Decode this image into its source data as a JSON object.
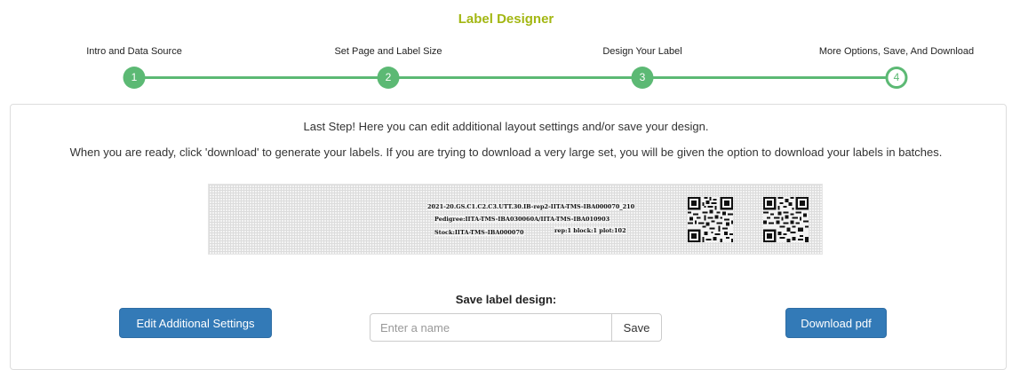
{
  "header": {
    "title": "Label Designer"
  },
  "wizard": {
    "steps": [
      {
        "number": "1",
        "label": "Intro and Data Source"
      },
      {
        "number": "2",
        "label": "Set Page and Label Size"
      },
      {
        "number": "3",
        "label": "Design Your Label"
      },
      {
        "number": "4",
        "label": "More Options, Save, And Download"
      }
    ],
    "active_step": 4,
    "accent_color": "#5cb974"
  },
  "main": {
    "line1": "Last Step! Here you can edit additional layout settings and/or save your design.",
    "line2": "When you are ready, click 'download' to generate your labels. If you are trying to download a very large set, you will be given the option to download your labels in batches."
  },
  "label_preview": {
    "plot_name": "2021-20.GS.C1.C2.C3.UTT.30.IB-rep2-IITA-TMS-IBA000070_210",
    "pedigree": "Pedigree:IITA-TMS-IBA030060A/IITA-TMS-IBA010903",
    "stock": "Stock:IITA-TMS-IBA000070",
    "position": "rep:1 block:1 plot:102"
  },
  "save": {
    "heading": "Save label design:",
    "input_placeholder": "Enter a name",
    "input_value": "",
    "save_label": "Save"
  },
  "buttons": {
    "edit_settings": "Edit Additional Settings",
    "download": "Download pdf",
    "primary_color": "#337ab7"
  }
}
